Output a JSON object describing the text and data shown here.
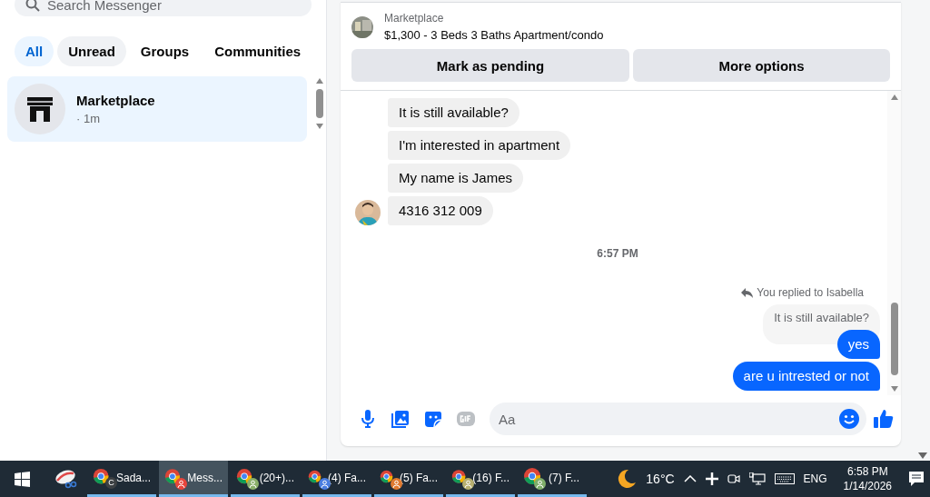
{
  "sidebar": {
    "search": {
      "placeholder": "Search Messenger"
    },
    "filters": [
      {
        "label": "All",
        "selected": true,
        "highlighted": false
      },
      {
        "label": "Unread",
        "selected": false,
        "highlighted": true
      },
      {
        "label": "Groups",
        "selected": false,
        "highlighted": false
      },
      {
        "label": "Communities",
        "selected": false,
        "highlighted": false
      }
    ],
    "conversations": [
      {
        "name": "Marketplace",
        "meta": "· 1m",
        "selected": true
      }
    ]
  },
  "listing": {
    "source": "Marketplace",
    "title": "$1,300 - 3 Beds 3 Baths Apartment/condo",
    "buttons": [
      "Mark as pending",
      "More options"
    ]
  },
  "thread": {
    "incoming": [
      {
        "text": "It is still available?",
        "avatar": false
      },
      {
        "text": "I'm interested in apartment",
        "avatar": false
      },
      {
        "text": "My name is James",
        "avatar": false
      },
      {
        "text": "4316 312 009",
        "avatar": true
      }
    ],
    "timestamp": "6:57 PM",
    "reply": {
      "note": "You replied to Isabella",
      "quote": "It is still available?"
    },
    "outgoing": [
      {
        "text": "yes"
      },
      {
        "text": "are u intrested or not"
      }
    ]
  },
  "composer": {
    "placeholder": "Aa"
  },
  "taskbar": {
    "apps": [
      {
        "label": "Sada...",
        "badge_letter": "C",
        "color": "#3c4043",
        "selected": false
      },
      {
        "label": "Mess...",
        "color": "#e8453c",
        "selected": true
      },
      {
        "label": "(20+)...",
        "color": "#8ab06a",
        "selected": false
      },
      {
        "label": "(4) Fa...",
        "color": "#4a7de0",
        "selected": false
      },
      {
        "label": "(5) Fa...",
        "color": "#e07a30",
        "selected": false
      },
      {
        "label": "(16) F...",
        "color": "#b8b070",
        "selected": false
      },
      {
        "label": "(7) F...",
        "color": "#7fae6a",
        "selected": false
      }
    ],
    "weather": "16°C",
    "language": "ENG",
    "time": "6:58 PM",
    "date": "1/14/2026"
  }
}
